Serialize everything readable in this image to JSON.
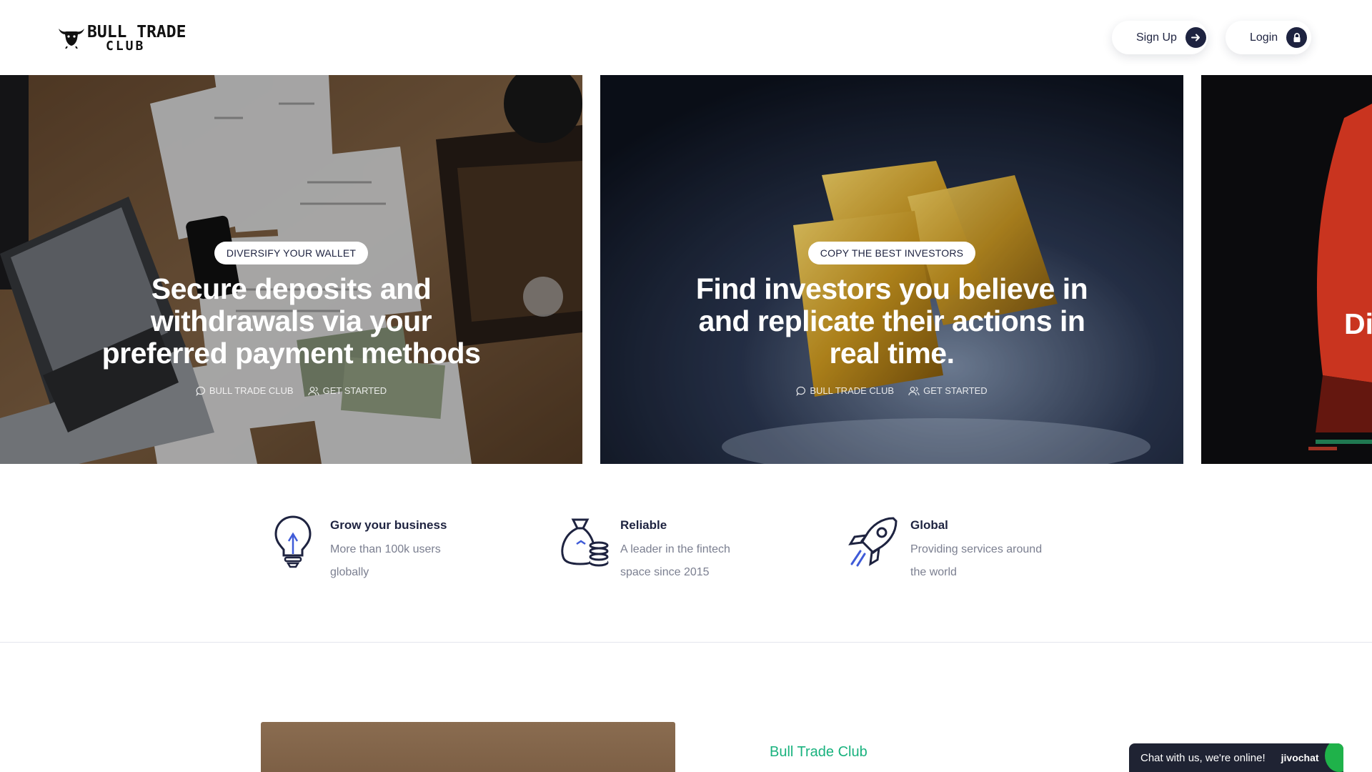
{
  "header": {
    "logo": {
      "line1": "BULL TRADE",
      "line2": "CLUB"
    },
    "signup_label": "Sign Up",
    "login_label": "Login"
  },
  "slides": [
    {
      "tag": "DIVERSIFY YOUR WALLET",
      "title": "Secure deposits and withdrawals via your preferred payment methods",
      "meta_author": "BULL TRADE CLUB",
      "meta_link": "GET STARTED"
    },
    {
      "tag": "COPY THE BEST INVESTORS",
      "title": "Find investors you believe in and replicate their actions in real time.",
      "meta_author": "BULL TRADE CLUB",
      "meta_link": "GET STARTED"
    },
    {
      "peek_text": "Di"
    }
  ],
  "features": [
    {
      "icon": "lightbulb-icon",
      "title": "Grow your business",
      "text": "More than 100k users globally"
    },
    {
      "icon": "money-bag-coins-icon",
      "title": "Reliable",
      "text": "A leader in the fintech space since 2015"
    },
    {
      "icon": "rocket-icon",
      "title": "Global",
      "text": "Providing services around the world"
    }
  ],
  "about": {
    "kicker": "Bull Trade Club"
  },
  "chat": {
    "message": "Chat with us, we're online!",
    "brand": "jivochat"
  },
  "colors": {
    "navy": "#1e2340",
    "accent_green": "#19b27e",
    "muted_text": "#7b7f90",
    "chat_bg": "#1f2333"
  }
}
